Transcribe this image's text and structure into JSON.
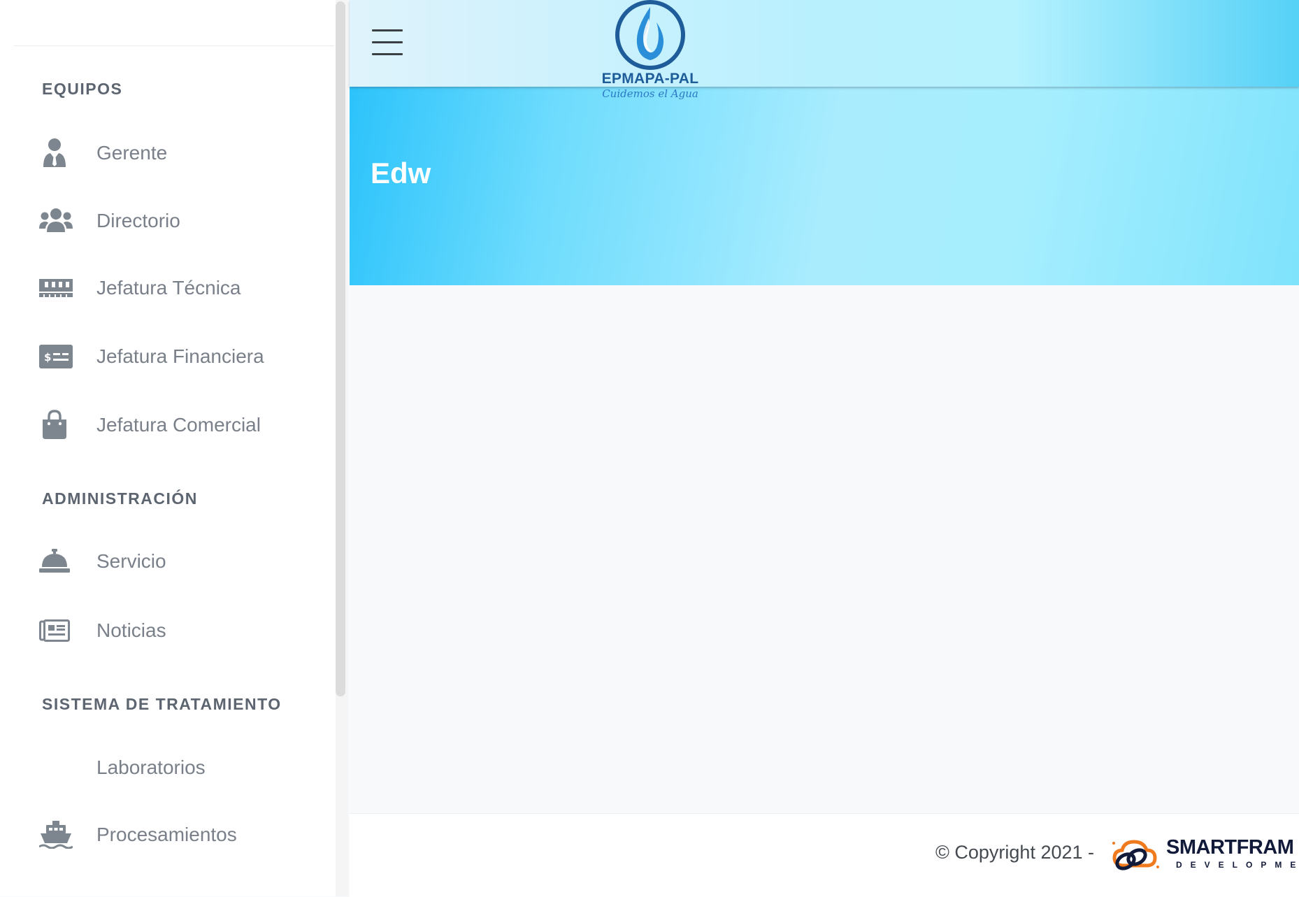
{
  "sidebar": {
    "sections": [
      {
        "title": "EQUIPOS",
        "items": [
          {
            "label": "Gerente",
            "icon": "user-tie-icon"
          },
          {
            "label": "Directorio",
            "icon": "users-icon"
          },
          {
            "label": "Jefatura Técnica",
            "icon": "memory-icon"
          },
          {
            "label": "Jefatura Financiera",
            "icon": "money-check-icon"
          },
          {
            "label": "Jefatura Comercial",
            "icon": "shopping-bag-icon"
          }
        ]
      },
      {
        "title": "ADMINISTRACIÓN",
        "items": [
          {
            "label": "Servicio",
            "icon": "concierge-bell-icon"
          },
          {
            "label": "Noticias",
            "icon": "newspaper-icon"
          }
        ]
      },
      {
        "title": "SISTEMA DE TRATAMIENTO",
        "items": [
          {
            "label": "Laboratorios",
            "icon": ""
          },
          {
            "label": "Procesamientos",
            "icon": "ship-icon"
          }
        ]
      }
    ]
  },
  "header": {
    "menu_icon": "hamburger-menu-icon",
    "logo_title": "EPMAPA-PAL",
    "logo_subtitle": "Cuidemos el Agua"
  },
  "banner": {
    "title": "Edw"
  },
  "footer": {
    "copyright": "© Copyright 2021 -",
    "brand_name": "SMARTFRAM",
    "brand_subtitle": "DEVELOPMEN"
  },
  "colors": {
    "sidebar_text": "#7a8089",
    "section_title": "#5c6570",
    "icon": "#7d858e",
    "banner_start": "#2cc3fb",
    "banner_end": "#a8ecfe",
    "logo_blue": "#1e5c9a",
    "brand_orange": "#f07a1e",
    "brand_navy": "#121a3a"
  }
}
